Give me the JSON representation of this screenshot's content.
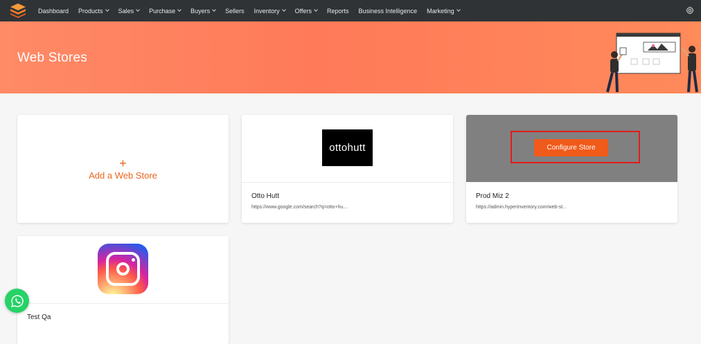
{
  "nav": {
    "items": [
      {
        "label": "Dashboard",
        "dropdown": false
      },
      {
        "label": "Products",
        "dropdown": true
      },
      {
        "label": "Sales",
        "dropdown": true
      },
      {
        "label": "Purchase",
        "dropdown": true
      },
      {
        "label": "Buyers",
        "dropdown": true
      },
      {
        "label": "Sellers",
        "dropdown": false
      },
      {
        "label": "Inventory",
        "dropdown": true
      },
      {
        "label": "Offers",
        "dropdown": true
      },
      {
        "label": "Reports",
        "dropdown": false
      },
      {
        "label": "Business Intelligence",
        "dropdown": false
      },
      {
        "label": "Marketing",
        "dropdown": true
      }
    ],
    "logo_icon": "stacked-layers-logo",
    "settings_icon": "gear-icon"
  },
  "banner": {
    "title": "Web Stores"
  },
  "add_card": {
    "plus": "+",
    "label": "Add a Web Store"
  },
  "stores": [
    {
      "name": "Otto Hutt",
      "url": "https://www.google.com/search?q=otto+hu...",
      "logo_text": "ottohutt"
    },
    {
      "name": "Prod Miz 2",
      "url": "https://admin.hyperinventory.com/web-st...",
      "action_label": "Configure Store"
    },
    {
      "name": "Test Qa"
    }
  ],
  "colors": {
    "accent": "#e8661d",
    "nav_bg": "#2f3336",
    "banner": "#ff7a59",
    "config_button": "#f05a1a",
    "highlight": "#e21c1c",
    "whatsapp": "#25d366"
  }
}
